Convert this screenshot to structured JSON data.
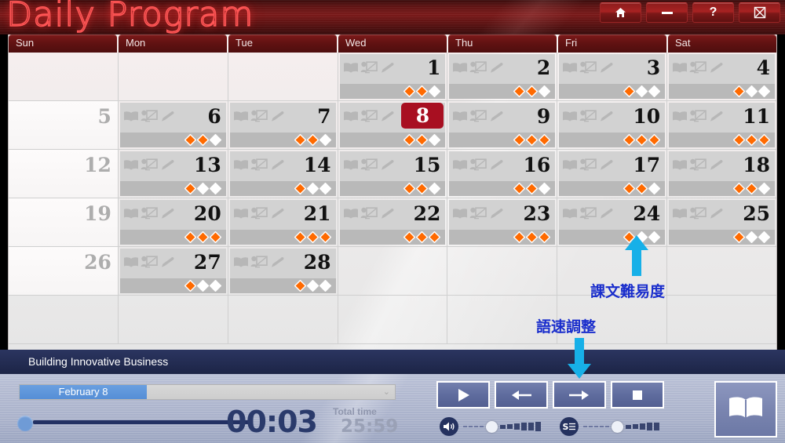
{
  "titlebar": {
    "app_title": "Daily Program",
    "buttons": [
      {
        "name": "home-button",
        "icon": "home-icon",
        "label": ""
      },
      {
        "name": "minimize-button",
        "icon": "minimize-icon",
        "label": ""
      },
      {
        "name": "help-button",
        "icon": "question-icon",
        "label": "?"
      },
      {
        "name": "close-button",
        "icon": "close-boxed-icon",
        "label": ""
      }
    ]
  },
  "calendar": {
    "day_headers": [
      "Sun",
      "Mon",
      "Tue",
      "Wed",
      "Thu",
      "Fri",
      "Sat"
    ],
    "today": 8,
    "cell_icons": [
      "book-icon",
      "presentation-icon",
      "pencil-icon"
    ],
    "weeks": [
      [
        {
          "day": "",
          "empty": true
        },
        {
          "day": "",
          "empty": true
        },
        {
          "day": "",
          "empty": true
        },
        {
          "day": "1",
          "difficulty": 2
        },
        {
          "day": "2",
          "difficulty": 2
        },
        {
          "day": "3",
          "difficulty": 1
        },
        {
          "day": "4",
          "difficulty": 1
        }
      ],
      [
        {
          "day": "5",
          "sunday": true
        },
        {
          "day": "6",
          "difficulty": 2
        },
        {
          "day": "7",
          "difficulty": 2
        },
        {
          "day": "8",
          "difficulty": 2,
          "today": true
        },
        {
          "day": "9",
          "difficulty": 3
        },
        {
          "day": "10",
          "difficulty": 3
        },
        {
          "day": "11",
          "difficulty": 3
        }
      ],
      [
        {
          "day": "12",
          "sunday": true
        },
        {
          "day": "13",
          "difficulty": 1
        },
        {
          "day": "14",
          "difficulty": 1
        },
        {
          "day": "15",
          "difficulty": 2
        },
        {
          "day": "16",
          "difficulty": 2
        },
        {
          "day": "17",
          "difficulty": 2
        },
        {
          "day": "18",
          "difficulty": 2
        }
      ],
      [
        {
          "day": "19",
          "sunday": true
        },
        {
          "day": "20",
          "difficulty": 3
        },
        {
          "day": "21",
          "difficulty": 3
        },
        {
          "day": "22",
          "difficulty": 3
        },
        {
          "day": "23",
          "difficulty": 3
        },
        {
          "day": "24",
          "difficulty": 1
        },
        {
          "day": "25",
          "difficulty": 1
        }
      ],
      [
        {
          "day": "26",
          "sunday": true
        },
        {
          "day": "27",
          "difficulty": 1
        },
        {
          "day": "28",
          "difficulty": 1
        },
        {
          "day": "",
          "empty": true
        },
        {
          "day": "",
          "empty": true
        },
        {
          "day": "",
          "empty": true
        },
        {
          "day": "",
          "empty": true
        }
      ],
      [
        {
          "day": "",
          "empty": true
        },
        {
          "day": "",
          "empty": true
        },
        {
          "day": "",
          "empty": true
        },
        {
          "day": "",
          "empty": true
        },
        {
          "day": "",
          "empty": true
        },
        {
          "day": "",
          "empty": true
        },
        {
          "day": "",
          "empty": true
        }
      ]
    ]
  },
  "player": {
    "lesson_title": "Building Innovative Business",
    "date_selected": "February 8",
    "current_time": "00:03",
    "total_time_label": "Total time",
    "total_time": "25:59",
    "seek_percent": 4,
    "controls": [
      {
        "name": "play-button",
        "icon": "play-icon"
      },
      {
        "name": "previous-button",
        "icon": "arrow-left-icon"
      },
      {
        "name": "next-button",
        "icon": "arrow-right-icon"
      },
      {
        "name": "stop-button",
        "icon": "stop-icon"
      }
    ],
    "volume_slider": {
      "icon": "speaker-icon",
      "dashes": 4,
      "bars": 6
    },
    "speed_slider": {
      "icon": "speed-text-icon",
      "dashes": 5,
      "bars": 5
    },
    "book_button": {
      "name": "open-book-button",
      "icon": "open-book-icon"
    }
  },
  "annotations": [
    {
      "id": "difficulty",
      "text": "課文難易度",
      "arrow": "up"
    },
    {
      "id": "speed",
      "text": "語速調整",
      "arrow": "down"
    }
  ],
  "colors": {
    "title_red": "#ff3b3b",
    "header_maroon": "#621212",
    "today_red": "#a80f21",
    "diamond_filled": "#ff6a00",
    "diamond_empty": "#ffffff",
    "player_blue": "#232c52",
    "annotation_blue": "#1a2ecc",
    "arrow_cyan": "#17b0e8"
  }
}
